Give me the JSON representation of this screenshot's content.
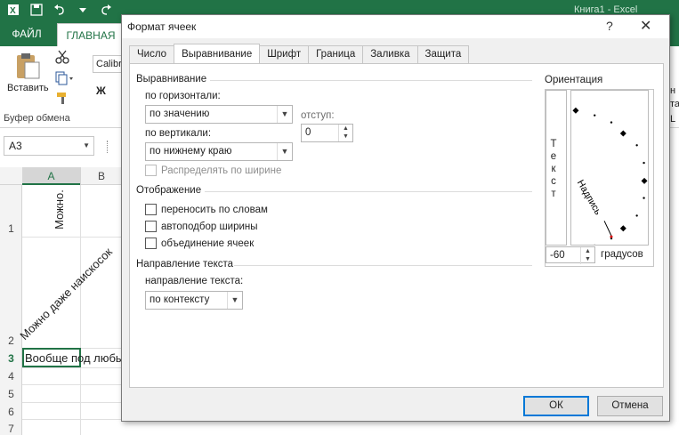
{
  "excel": {
    "app_title": "Книга1 - Excel",
    "tab_file": "ФАЙЛ",
    "tab_home": "ГЛАВНАЯ",
    "paste_label": "Вставить",
    "font_name": "Calibr",
    "bold_glyph": "Ж",
    "clipboard_group": "Буфер обмена",
    "ribbon_right_1": "н",
    "ribbon_right_2": "та",
    "ribbon_right_3": "L",
    "name_box": "A3",
    "col_a": "A",
    "col_b": "B",
    "rows": [
      "1",
      "2",
      "3",
      "4",
      "5",
      "6",
      "7"
    ],
    "cell_a1": "Можно.",
    "cell_a2": "Можно даже наискосок",
    "cell_a3": "Вообще под любым"
  },
  "dialog": {
    "title": "Формат ячеек",
    "help": "?",
    "close": "✕",
    "tabs": [
      "Число",
      "Выравнивание",
      "Шрифт",
      "Граница",
      "Заливка",
      "Защита"
    ],
    "alignment_section": "Выравнивание",
    "horizontal_label": "по горизонтали:",
    "horizontal_value": "по значению",
    "indent_label": "отступ:",
    "indent_value": "0",
    "vertical_label": "по вертикали:",
    "vertical_value": "по нижнему краю",
    "distribute_label": "Распределять по ширине",
    "display_section": "Отображение",
    "wrap_label": "переносить по словам",
    "shrink_label": "автоподбор ширины",
    "merge_label": "объединение ячеек",
    "direction_section": "Направление текста",
    "direction_label": "направление текста:",
    "direction_value": "по контексту",
    "orientation_section": "Ориентация",
    "vertical_text": "Т е к с т",
    "dial_text": "Надпись",
    "degrees_value": "-60",
    "degrees_label": "градусов",
    "ok": "ОК",
    "cancel": "Отмена"
  }
}
